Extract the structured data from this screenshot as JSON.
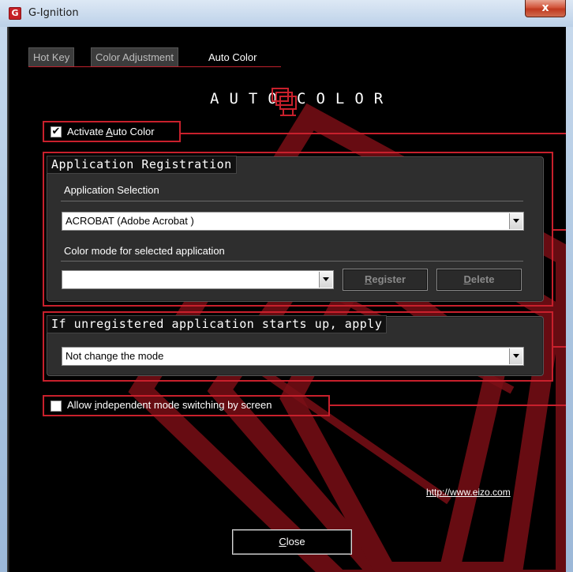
{
  "window": {
    "title": "G-Ignition",
    "app_icon_letter": "G",
    "close_glyph": "x"
  },
  "tabs": [
    {
      "label": "Hot Key",
      "active": false
    },
    {
      "label": "Color Adjustment",
      "active": false
    },
    {
      "label": "Auto Color",
      "active": true
    }
  ],
  "heading": {
    "left": "AUTO",
    "right": "COLOR"
  },
  "activate": {
    "checked": true,
    "label_pre": "Activate ",
    "label_accel": "A",
    "label_post": "uto Color"
  },
  "app_registration": {
    "title": "Application Registration",
    "selection_label": "Application Selection",
    "selection_value": "ACROBAT (Adobe Acrobat )",
    "mode_label": "Color mode for selected application",
    "mode_value": "",
    "register_pre": "",
    "register_accel": "R",
    "register_post": "egister",
    "delete_pre": "",
    "delete_accel": "D",
    "delete_post": "elete"
  },
  "unregistered": {
    "title": "If unregistered application starts up, apply",
    "value": "Not change the mode"
  },
  "independent": {
    "checked": false,
    "label_pre": "Allow ",
    "label_accel": "i",
    "label_post": "ndependent mode switching by screen"
  },
  "link": "http://www.eizo.com",
  "close_button": {
    "accel": "C",
    "rest": "lose"
  },
  "colors": {
    "highlight": "#c8202c",
    "watermark": "#7a0f16",
    "background": "#000000"
  }
}
